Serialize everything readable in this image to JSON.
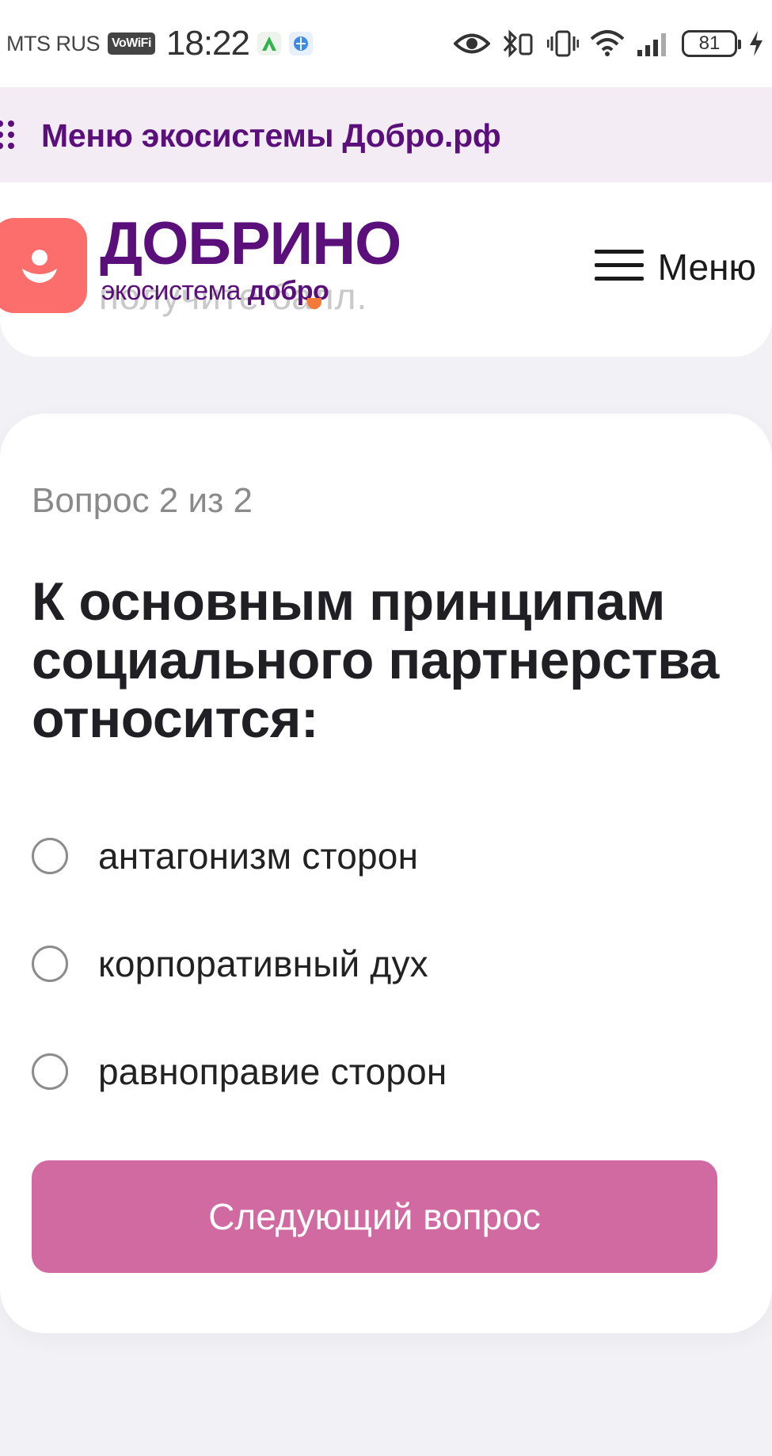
{
  "status_bar": {
    "carrier": "MTS RUS",
    "vowifi_label": "VoWiFi",
    "time": "18:22",
    "battery": "81",
    "icons": [
      "eye-icon",
      "bluetooth-icon",
      "vibrate-icon",
      "wifi-icon",
      "signal-icon",
      "charging-icon"
    ]
  },
  "eco_bar": {
    "label": "Меню экосистемы Добро.рф"
  },
  "header": {
    "ghost_text": "получите балл.",
    "logo_title": "ДОБРИНО",
    "logo_sub_regular": "экосистема ",
    "logo_sub_bold": "добро",
    "menu_label": "Меню"
  },
  "quiz": {
    "counter": "Вопрос 2 из 2",
    "question": "К основным принципам социального партнерства относится:",
    "options": [
      {
        "label": "антагонизм сторон",
        "selected": false
      },
      {
        "label": "корпоративный дух",
        "selected": false
      },
      {
        "label": "равноправие сторон",
        "selected": false
      }
    ],
    "next_button": "Следующий вопрос"
  },
  "colors": {
    "brand_purple": "#5a0f7a",
    "logo_coral": "#fb6e6b",
    "button_pink": "#d16aa1",
    "eco_bar_bg": "#f3ecf4"
  }
}
